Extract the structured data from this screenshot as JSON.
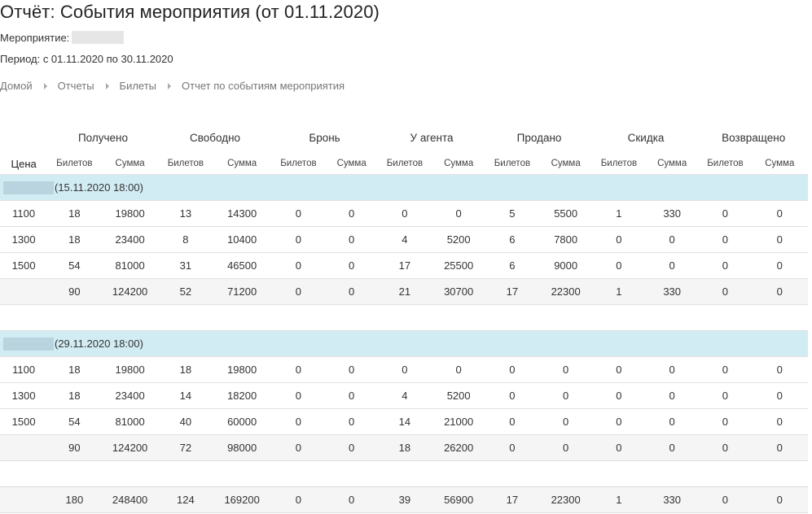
{
  "page": {
    "title": "Отчёт: События мероприятия (от 01.11.2020)",
    "event_label": "Мероприятие:",
    "period": "Период: с 01.11.2020 по 30.11.2020"
  },
  "breadcrumbs": [
    "Домой",
    "Отчеты",
    "Билеты",
    "Отчет по событиям мероприятия"
  ],
  "table": {
    "price_header": "Цена",
    "group_headers": [
      "Получено",
      "Свободно",
      "Бронь",
      "У агента",
      "Продано",
      "Скидка",
      "Возвращено"
    ],
    "sub_headers": [
      "Билетов",
      "Сумма"
    ],
    "events": [
      {
        "date": "(15.11.2020 18:00)",
        "rows": [
          {
            "price": "1100",
            "cells": [
              "18",
              "19800",
              "13",
              "14300",
              "0",
              "0",
              "0",
              "0",
              "5",
              "5500",
              "1",
              "330",
              "0",
              "0"
            ]
          },
          {
            "price": "1300",
            "cells": [
              "18",
              "23400",
              "8",
              "10400",
              "0",
              "0",
              "4",
              "5200",
              "6",
              "7800",
              "0",
              "0",
              "0",
              "0"
            ]
          },
          {
            "price": "1500",
            "cells": [
              "54",
              "81000",
              "31",
              "46500",
              "0",
              "0",
              "17",
              "25500",
              "6",
              "9000",
              "0",
              "0",
              "0",
              "0"
            ]
          }
        ],
        "subtotal": [
          "90",
          "124200",
          "52",
          "71200",
          "0",
          "0",
          "21",
          "30700",
          "17",
          "22300",
          "1",
          "330",
          "0",
          "0"
        ]
      },
      {
        "date": "(29.11.2020 18:00)",
        "rows": [
          {
            "price": "1100",
            "cells": [
              "18",
              "19800",
              "18",
              "19800",
              "0",
              "0",
              "0",
              "0",
              "0",
              "0",
              "0",
              "0",
              "0",
              "0"
            ]
          },
          {
            "price": "1300",
            "cells": [
              "18",
              "23400",
              "14",
              "18200",
              "0",
              "0",
              "4",
              "5200",
              "0",
              "0",
              "0",
              "0",
              "0",
              "0"
            ]
          },
          {
            "price": "1500",
            "cells": [
              "54",
              "81000",
              "40",
              "60000",
              "0",
              "0",
              "14",
              "21000",
              "0",
              "0",
              "0",
              "0",
              "0",
              "0"
            ]
          }
        ],
        "subtotal": [
          "90",
          "124200",
          "72",
          "98000",
          "0",
          "0",
          "18",
          "26200",
          "0",
          "0",
          "0",
          "0",
          "0",
          "0"
        ]
      }
    ],
    "grand_total": [
      "180",
      "248400",
      "124",
      "169200",
      "0",
      "0",
      "39",
      "56900",
      "17",
      "22300",
      "1",
      "330",
      "0",
      "0"
    ]
  },
  "colors": {
    "group_row_bg": "#d2ecf4",
    "subtotal_row_bg": "#f5f5f5"
  }
}
